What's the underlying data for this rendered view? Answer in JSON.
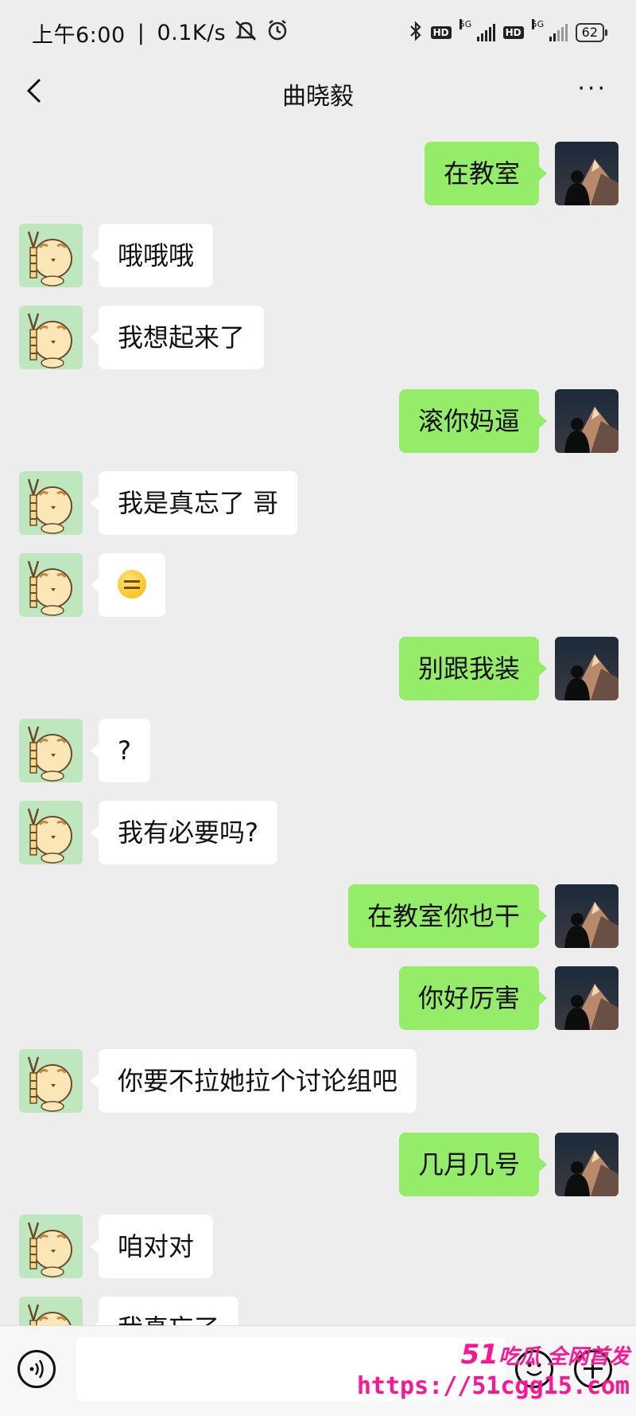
{
  "status_bar": {
    "time": "上午6:00",
    "speed": "0.1K/s",
    "battery": "62",
    "net1": "5G",
    "net2": "5G",
    "hd": "HD"
  },
  "header": {
    "title": "曲晓毅",
    "more": "···"
  },
  "messages": [
    {
      "from": "me",
      "text": "在教室"
    },
    {
      "from": "them",
      "text": "哦哦哦"
    },
    {
      "from": "them",
      "text": "我想起来了"
    },
    {
      "from": "me",
      "text": "滚你妈逼"
    },
    {
      "from": "them",
      "text": "我是真忘了 哥"
    },
    {
      "from": "them",
      "text": "",
      "emoji": "expressionless-sweat-emoji"
    },
    {
      "from": "me",
      "text": "别跟我装"
    },
    {
      "from": "them",
      "text": "?"
    },
    {
      "from": "them",
      "text": "我有必要吗?"
    },
    {
      "from": "me",
      "text": "在教室你也干"
    },
    {
      "from": "me",
      "text": "你好厉害"
    },
    {
      "from": "them",
      "text": "你要不拉她拉个讨论组吧"
    },
    {
      "from": "me",
      "text": "几月几号"
    },
    {
      "from": "them",
      "text": "咱对对"
    },
    {
      "from": "them",
      "text": "我真忘了"
    }
  ],
  "watermark": {
    "line1_num": "51",
    "line1_text": "吃瓜 全网首发",
    "line2": "https://51cgg15.com"
  }
}
